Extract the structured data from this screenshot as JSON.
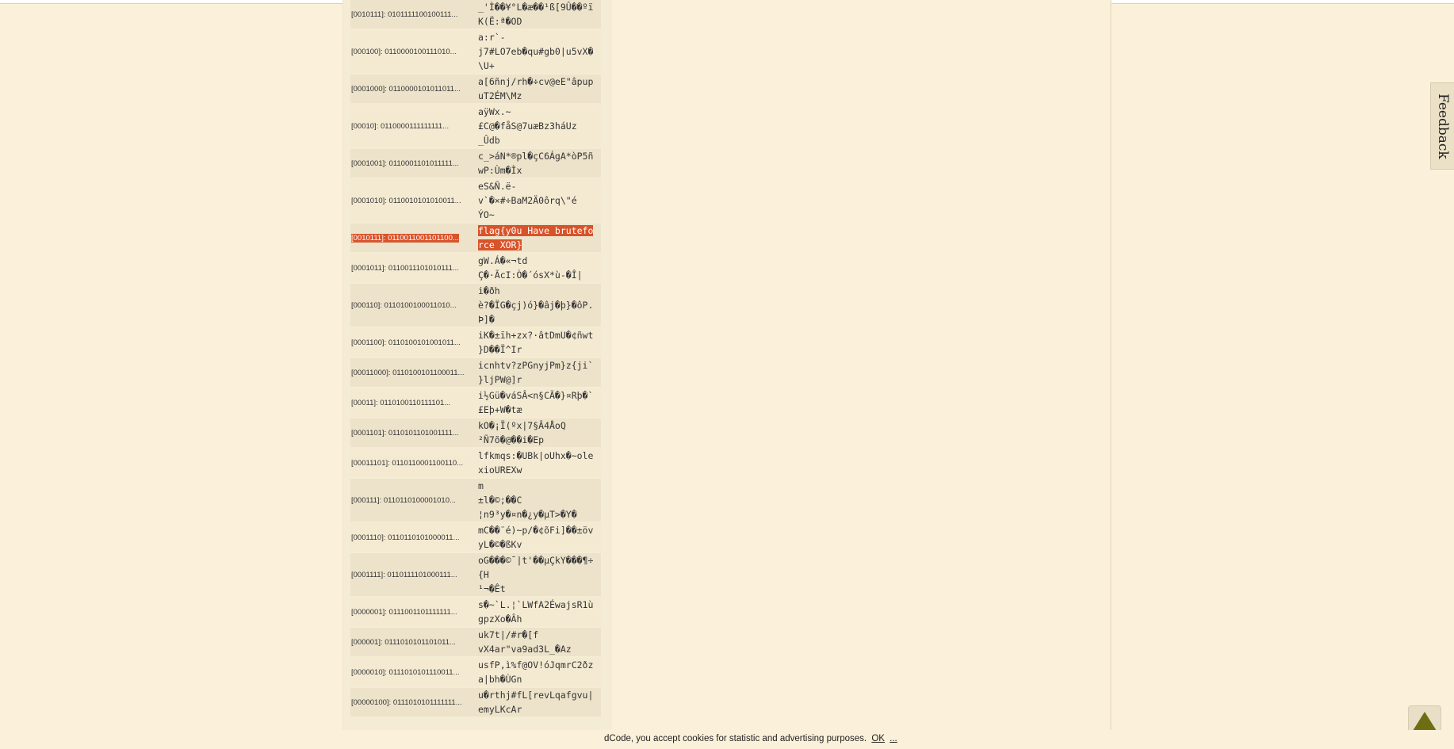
{
  "results": [
    {
      "key": "[0010111]: 0101111100100111...",
      "value": "_'Ì��¥°L�æ��¹ß[9Û��ºï\nK(Ë:ª�OD"
    },
    {
      "key": "[000100]: 0110000100111010...",
      "value": "a:r`-\nj7#LO7eb�qu#gb0|u5vX�\n\\U+"
    },
    {
      "key": "[0001000]: 0110000101011011...",
      "value": "a[6ñnj/rh�÷cv@eE\"âpup\nuT2ÉM\\Mz"
    },
    {
      "key": "[00010]: 0110000111111111...",
      "value": "aÿWx.~\n£C@�fåS@7uæBz3háUz\n_Ûdb"
    },
    {
      "key": "[0001001]: 0110001101011111...",
      "value": "c_>áN*®pl�çC6ÁgA*òP5ñ\nwP:Ùm�Ìx"
    },
    {
      "key": "[0001010]: 0110010101010011...",
      "value": "eS&Ñ.ë-\nv`�×#÷BaM2Ä0ôrq\\\"é\nÝO~"
    },
    {
      "key": "[0010111]: 0110011001101100...",
      "value": "flag{y0u Have brutefo\nrce XOR}",
      "highlight": true
    },
    {
      "key": "[0001011]: 0110011101010111...",
      "value": "gW.Á�«¬td\nÇ�·ÃcI:Ò�´ósX*ù-�Î|"
    },
    {
      "key": "[000110]: 0110100100011010...",
      "value": "i�ðh\nè?�ÏG�çj)ó}�âj�þ}�ôP.\nÞ]�"
    },
    {
      "key": "[0001100]: 0110100101001011...",
      "value": "iK�±ïh+zx?·âtDmU�¢ñwt\n}D��Ï^Ir"
    },
    {
      "key": "[00011000]: 0110100101100011...",
      "value": "icnhtv?zPGnyjPm}z{ji`\n}ljPW@]r"
    },
    {
      "key": "[00011]: 0110100110111101...",
      "value": "i½Gü�váSÂ<n§CÃ�}¤Rþ�`\n£Eþ+W�tæ"
    },
    {
      "key": "[0001101]: 0110101101001111...",
      "value": "kO�¡Ï(ºx|7§Â4ÅoQ\n²Ñ7õ�@��i�Ep"
    },
    {
      "key": "[00011101]: 0110110001100110...",
      "value": "lfkmqs:�UBk|oUhx�~ole\nxioUREXw"
    },
    {
      "key": "[000111]: 0110110100001010...",
      "value": "m\n±l�©;��C\n¦n9³y�¤n�¿y�µT>�Y�"
    },
    {
      "key": "[0001110]: 0110110101000011...",
      "value": "mC��¨é)~p/�¢õFi]��±öv\nyL�©�ßKv"
    },
    {
      "key": "[0001111]: 0110111101000111...",
      "value": "oG���©¯|t'��µÇkY���¶÷\n{H\n¹¬�Êt"
    },
    {
      "key": "[0000001]: 0111001101111111...",
      "value": "s�~`L.¦`LWfA2ÉwajsR1ù\ngpzXo�Âh"
    },
    {
      "key": "[000001]: 0111010101101011...",
      "value": "uk7t|/#r�[f\nvX4ar\"va9ad3L_�Az"
    },
    {
      "key": "[0000010]: 0111010101110011...",
      "value": "usfP,ì%f@OV!óJqmrC2ðz\na|bh�ÙGn"
    },
    {
      "key": "[00000100]: 0111010101111111...",
      "value": "u�rthj#fL[revLqafgvu|\nemyLKcAr"
    }
  ],
  "feedback_label": "Feedback",
  "cookie": {
    "text": "dCode, you accept cookies for statistic and advertising purposes.",
    "ok": "OK",
    "more": "..."
  },
  "colors": {
    "highlight": "#d9532a",
    "scroll_top_arrow": "#6f6d12",
    "background": "#fbf0d9"
  },
  "icons": {
    "scroll_top": "triangle-up-icon"
  }
}
